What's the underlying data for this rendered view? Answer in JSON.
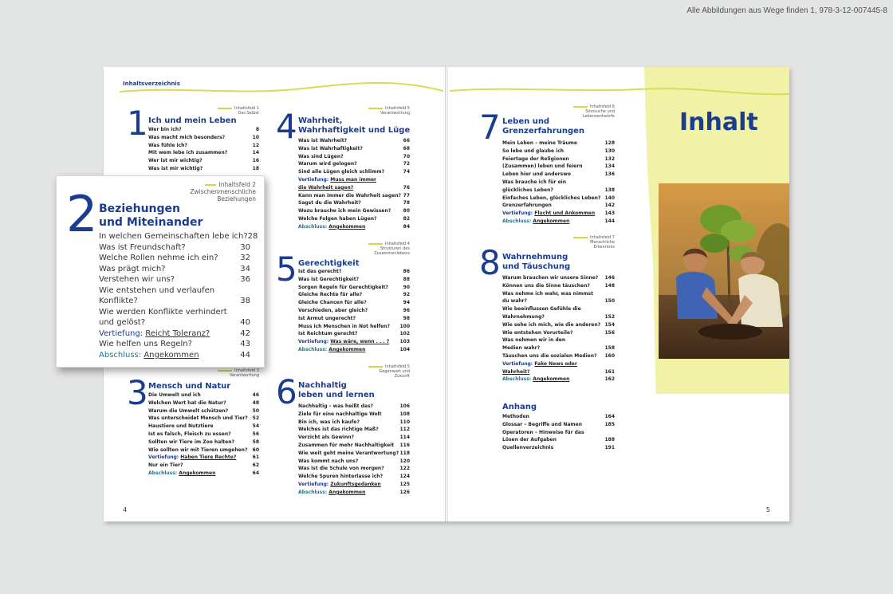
{
  "credit": "Alle Abbildungen aus Wege finden 1, 978-3-12-007445-8",
  "left_page": {
    "header": "Inhaltsverzeichnis",
    "page_number": "4"
  },
  "right_page": {
    "page_number": "5",
    "title": "Inhalt"
  },
  "sections": {
    "s1": {
      "num": "1",
      "title": "Ich und mein Leben",
      "field": [
        "Inhaltsfeld 1",
        "Das Selbst"
      ],
      "rows": [
        {
          "t": "Wer bin ich?",
          "p": "8"
        },
        {
          "t": "Was macht mich besonders?",
          "p": "10"
        },
        {
          "t": "Was fühle ich?",
          "p": "12"
        },
        {
          "t": "Mit wem lebe ich zusammen?",
          "p": "14"
        },
        {
          "t": "Wer ist mir wichtig?",
          "p": "16"
        },
        {
          "t": "Was ist mir wichtig?",
          "p": "18"
        }
      ]
    },
    "s3": {
      "num": "3",
      "title": "Mensch und Natur",
      "field": [
        "Inhaltsfeld 3",
        "Verantwortung"
      ],
      "rows": [
        {
          "t": "Die Umwelt und ich",
          "p": "46"
        },
        {
          "t": "Welchen Wert hat die Natur?",
          "p": "48"
        },
        {
          "t": "Warum die Umwelt schützen?",
          "p": "50"
        },
        {
          "t": "Was unterscheidet Mensch und Tier?",
          "p": "52"
        },
        {
          "t": "Haustiere und Nutztiere",
          "p": "54"
        },
        {
          "t": "Ist es falsch, Fleisch zu essen?",
          "p": "56"
        },
        {
          "t": "Sollten wir Tiere im Zoo halten?",
          "p": "58"
        },
        {
          "t": "Wie sollten wir mit Tieren umgehen?",
          "p": "60"
        },
        {
          "t": "Haben Tiere Rechte?",
          "p": "61",
          "k": "v",
          "lab": "Vertiefung: "
        },
        {
          "t": "Nur ein Tier?",
          "p": "62"
        },
        {
          "t": "Angekommen",
          "p": "64",
          "k": "a",
          "lab": "Abschluss: "
        }
      ]
    },
    "s4": {
      "num": "4",
      "title": "Wahrheit,\nWahrhaftigkeit und Lüge",
      "field": [
        "Inhaltsfeld 5",
        "Verantwortung"
      ],
      "rows": [
        {
          "t": "Was ist Wahrheit?",
          "p": "66"
        },
        {
          "t": "Was ist Wahrhaftigkeit?",
          "p": "68"
        },
        {
          "t": "Was sind Lügen?",
          "p": "70"
        },
        {
          "t": "Warum wird gelogen?",
          "p": "72"
        },
        {
          "t": "Sind alle Lügen gleich schlimm?",
          "p": "74"
        },
        {
          "t": "Muss man immer\ndie Wahrheit sagen?",
          "p": "76",
          "k": "v",
          "lab": "Vertiefung: "
        },
        {
          "t": "Kann man immer die Wahrheit sagen?",
          "p": "77"
        },
        {
          "t": "Sagst du die Wahrheit?",
          "p": "78"
        },
        {
          "t": "Wozu brauche ich mein Gewissen?",
          "p": "80"
        },
        {
          "t": "Welche Folgen haben Lügen?",
          "p": "82"
        },
        {
          "t": "Angekommen",
          "p": "84",
          "k": "a",
          "lab": "Abschluss: "
        }
      ]
    },
    "s5": {
      "num": "5",
      "title": "Gerechtigkeit",
      "field": [
        "Inhaltsfeld 4",
        "Strukturen des",
        "Zusammenlebens"
      ],
      "rows": [
        {
          "t": "Ist das gerecht?",
          "p": "86"
        },
        {
          "t": "Was ist Gerechtigkeit?",
          "p": "88"
        },
        {
          "t": "Sorgen Regeln für Gerechtigkeit?",
          "p": "90"
        },
        {
          "t": "Gleiche Rechte für alle?",
          "p": "92"
        },
        {
          "t": "Gleiche Chancen für alle?",
          "p": "94"
        },
        {
          "t": "Verschieden, aber gleich?",
          "p": "96"
        },
        {
          "t": "Ist Armut ungerecht?",
          "p": "98"
        },
        {
          "t": "Muss ich Menschen in Not helfen?",
          "p": "100"
        },
        {
          "t": "Ist Reichtum gerecht?",
          "p": "102"
        },
        {
          "t": "Was wäre, wenn . . . ?",
          "p": "103",
          "k": "v",
          "lab": "Vertiefung: "
        },
        {
          "t": "Angekommen",
          "p": "104",
          "k": "a",
          "lab": "Abschluss: "
        }
      ]
    },
    "s6": {
      "num": "6",
      "title": "Nachhaltig\nleben und lernen",
      "field": [
        "Inhaltsfeld 5",
        "Gegenwart und",
        "Zukunft"
      ],
      "rows": [
        {
          "t": "Nachhaltig – was heißt das?",
          "p": "106"
        },
        {
          "t": "Ziele für eine nachhaltige Welt",
          "p": "108"
        },
        {
          "t": "Bin ich, was ich kaufe?",
          "p": "110"
        },
        {
          "t": "Welches ist das richtige Maß?",
          "p": "112"
        },
        {
          "t": "Verzicht als Gewinn?",
          "p": "114"
        },
        {
          "t": "Zusammen für mehr Nachhaltigkeit",
          "p": "116"
        },
        {
          "t": "Wie weit geht meine Verantwortung?",
          "p": "118"
        },
        {
          "t": "Was kommt nach uns?",
          "p": "120"
        },
        {
          "t": "Was ist die Schule von morgen?",
          "p": "122"
        },
        {
          "t": "Welche Spuren hinterlasse ich?",
          "p": "124"
        },
        {
          "t": "Zukunftsgedanken",
          "p": "125",
          "k": "v",
          "lab": "Vertiefung: "
        },
        {
          "t": "Angekommen",
          "p": "126",
          "k": "a",
          "lab": "Abschluss: "
        }
      ]
    },
    "s7": {
      "num": "7",
      "title": "Leben und\nGrenzerfahrungen",
      "field": [
        "Inhaltsfeld 6",
        "Sinnsuche und",
        "Lebensentwürfe"
      ],
      "rows": [
        {
          "t": "Mein Leben – meine Träume",
          "p": "128"
        },
        {
          "t": "So lebe und glaube ich",
          "p": "130"
        },
        {
          "t": "Feiertage der Religionen",
          "p": "132"
        },
        {
          "t": "(Zusammen) leben und feiern",
          "p": "134"
        },
        {
          "t": "Leben hier und anderswo",
          "p": "136"
        },
        {
          "t": "Was brauche ich für ein\nglückliches Leben?",
          "p": "138"
        },
        {
          "t": "Einfaches Leben, glückliches Leben?",
          "p": "140"
        },
        {
          "t": "Grenzerfahrungen",
          "p": "142"
        },
        {
          "t": "Flucht und Ankommen",
          "p": "143",
          "k": "v",
          "lab": "Vertiefung: "
        },
        {
          "t": "Angekommen",
          "p": "144",
          "k": "a",
          "lab": "Abschluss: "
        }
      ]
    },
    "s8": {
      "num": "8",
      "title": "Wahrnehmung\nund Täuschung",
      "field": [
        "Inhaltsfeld 7",
        "Menschliche",
        "Erkenntnis"
      ],
      "rows": [
        {
          "t": "Warum brauchen wir unsere Sinne?",
          "p": "146"
        },
        {
          "t": "Können uns die Sinne täuschen?",
          "p": "148"
        },
        {
          "t": "Was nehme ich wahr, was nimmst\ndu wahr?",
          "p": "150"
        },
        {
          "t": "Wie beeinflussen Gefühle die\nWahrnehmung?",
          "p": "152"
        },
        {
          "t": "Wie sehe ich mich, wie die anderen?",
          "p": "154"
        },
        {
          "t": "Wie entstehen Vorurteile?",
          "p": "156"
        },
        {
          "t": "Was nehmen wir in den\nMedien wahr?",
          "p": "158"
        },
        {
          "t": "Täuschen uns die sozialen Medien?",
          "p": "160"
        },
        {
          "t": "Fake News oder\nWahrheit?",
          "p": "161",
          "k": "v",
          "lab": "Vertiefung: "
        },
        {
          "t": "Angekommen",
          "p": "162",
          "k": "a",
          "lab": "Abschluss: "
        }
      ]
    },
    "anhang": {
      "title": "Anhang",
      "rows": [
        {
          "t": "Methoden",
          "p": "164"
        },
        {
          "t": "Glossar – Begriffe und Namen",
          "p": "185"
        },
        {
          "t": "Operatoren – Hinweise für das\nLösen der Aufgaben",
          "p": "188"
        },
        {
          "t": "Quellenverzeichnis",
          "p": "191"
        }
      ]
    },
    "zoom": {
      "num": "2",
      "title": "Beziehungen\nund Miteinander",
      "field": [
        "Inhaltsfeld 2",
        "Zwischenmenschliche",
        "Beziehungen"
      ],
      "rows": [
        {
          "t": "In welchen Gemeinschaften lebe ich?",
          "p": "28"
        },
        {
          "t": "Was ist Freundschaft?",
          "p": "30"
        },
        {
          "t": "Welche Rollen nehme ich ein?",
          "p": "32"
        },
        {
          "t": "Was prägt mich?",
          "p": "34"
        },
        {
          "t": "Verstehen wir uns?",
          "p": "36"
        },
        {
          "t": "Wie entstehen und verlaufen\nKonflikte?",
          "p": "38"
        },
        {
          "t": "Wie werden Konflikte verhindert\nund gelöst?",
          "p": "40"
        },
        {
          "t": "Reicht Toleranz?",
          "p": "42",
          "k": "v",
          "lab": "Vertiefung: "
        },
        {
          "t": "Wie helfen uns Regeln?",
          "p": "43"
        },
        {
          "t": "Angekommen",
          "p": "44",
          "k": "a",
          "lab": "Abschluss: "
        }
      ]
    }
  }
}
